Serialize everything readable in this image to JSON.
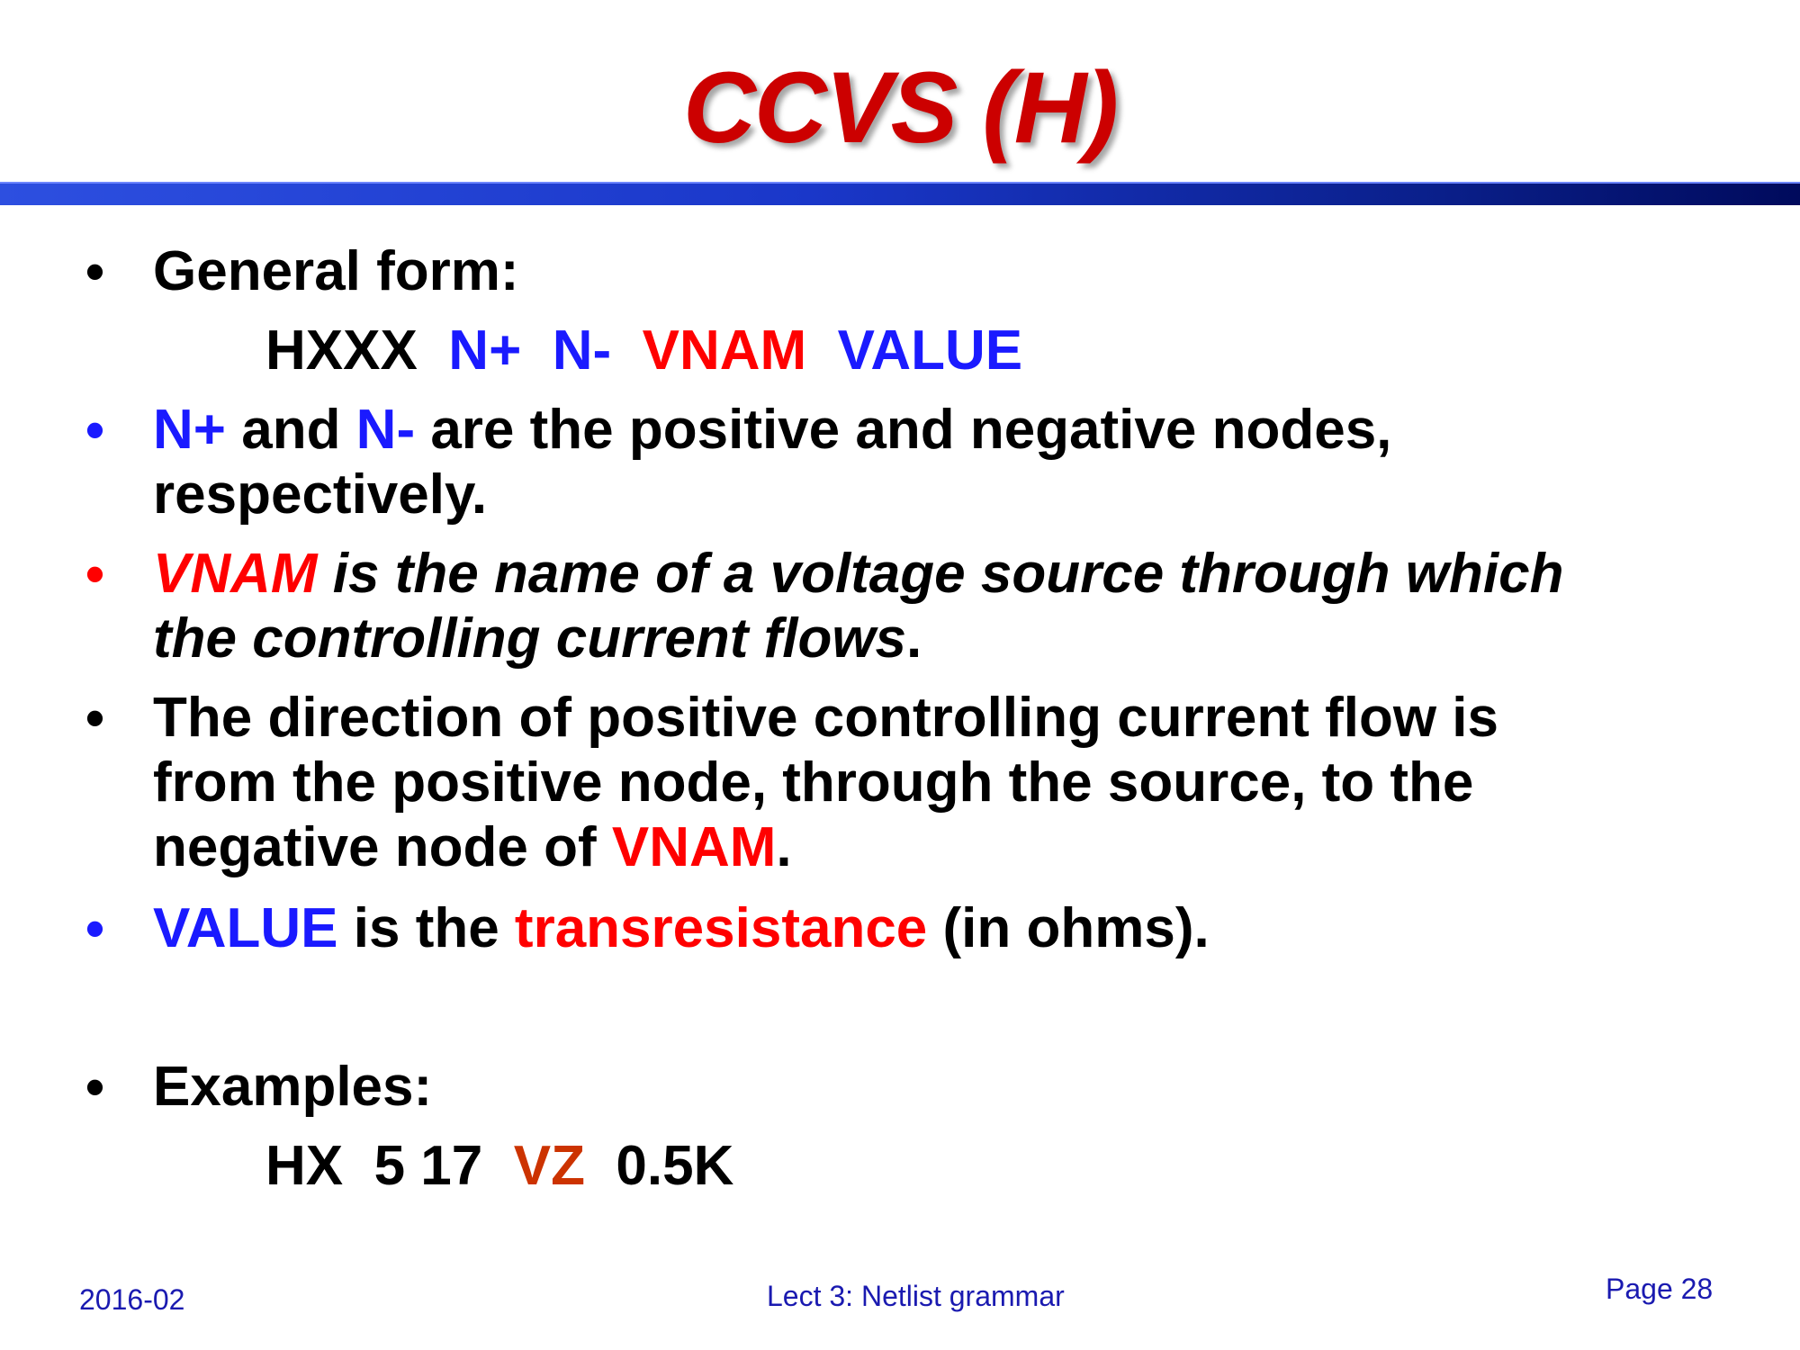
{
  "title": "CCVS (H)",
  "bullets": {
    "b1": {
      "marker": "•",
      "text": "General form:"
    },
    "general_form": {
      "name": "HXXX",
      "n_plus": "N+",
      "n_minus": "N-",
      "vnam": "VNAM",
      "value": "VALUE"
    },
    "b2": {
      "marker": "•",
      "n_plus": "N+",
      "and": " and ",
      "n_minus": "N-",
      "rest_line1": " are the positive and negative nodes,",
      "line2": "respectively."
    },
    "b3": {
      "marker": "•",
      "vnam": "VNAM",
      "rest_line1": " is the name of a voltage source through which",
      "line2": "the controlling current flows",
      "period": "."
    },
    "b4": {
      "marker": "•",
      "line1": "The direction of positive controlling current flow is",
      "line2": "from the positive node, through the source, to the",
      "line3_pre": "negative node of ",
      "vnam": "VNAM",
      "period": "."
    },
    "b5": {
      "marker": "•",
      "value": "VALUE",
      "is_the": " is the ",
      "transresistance": "transresistance",
      "rest": " (in ohms)."
    },
    "b6": {
      "marker": "•",
      "text": "Examples:"
    },
    "example": {
      "name": "HX",
      "nodes": "5 17",
      "vz": "VZ",
      "val": "0.5K"
    }
  },
  "footer": {
    "date": "2016-02",
    "center": "Lect 3: Netlist grammar",
    "page": "Page 28"
  },
  "colors": {
    "title": "#cc0000",
    "rule": "#1a37c9",
    "blue": "#1a1aff",
    "red": "#ff0000",
    "orange": "#cc3300",
    "footer": "#1a1ab0"
  }
}
